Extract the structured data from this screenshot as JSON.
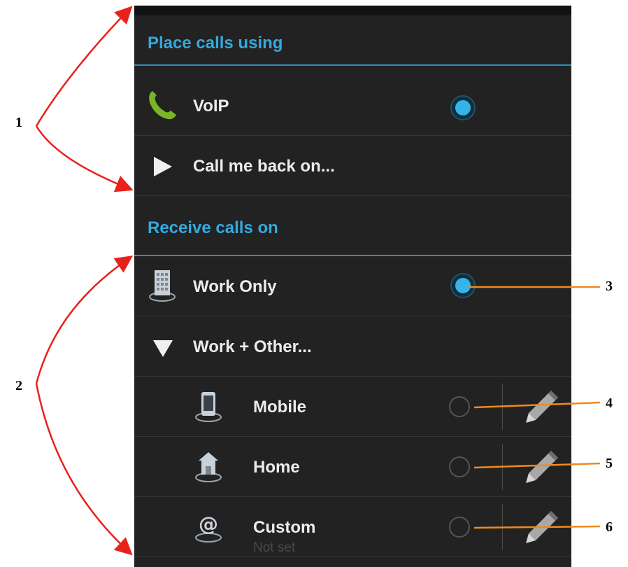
{
  "place_calls": {
    "header": "Place calls using",
    "options": [
      {
        "label": "VoIP",
        "icon": "phone-handset-icon",
        "selected": true
      },
      {
        "label": "Call me back on...",
        "icon": "expand-arrow-icon"
      }
    ]
  },
  "receive_calls": {
    "header": "Receive calls on",
    "options": [
      {
        "label": "Work Only",
        "icon": "office-building-icon",
        "selected": true
      },
      {
        "label": "Work + Other...",
        "icon": "collapse-arrow-icon"
      }
    ],
    "sub_options": [
      {
        "label": "Mobile",
        "icon": "mobile-phone-icon",
        "selected": false
      },
      {
        "label": "Home",
        "icon": "house-icon",
        "selected": false
      },
      {
        "label": "Custom",
        "sublabel": "Not set",
        "icon": "at-sign-icon",
        "selected": false
      }
    ]
  },
  "callouts": [
    "1",
    "2",
    "3",
    "4",
    "5",
    "6"
  ],
  "colors": {
    "accent": "#35a9de",
    "divider_accent": "#2a8fb5",
    "background": "#222222",
    "annotation_red": "#e8211c",
    "annotation_orange": "#f08a1c",
    "phone_green": "#79b527"
  }
}
